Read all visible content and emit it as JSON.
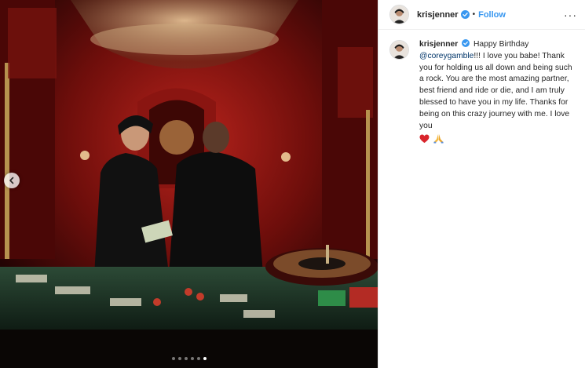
{
  "post": {
    "username": "krisjenner",
    "separator": "•",
    "follow_label": "Follow",
    "more_label": "···",
    "caption": {
      "greeting": "Happy Birthday",
      "mention": "@coreygamble",
      "text": "!!! I love you babe! Thank you for holding us all down and being such a rock. You are the most amazing partner, best friend and ride or die, and I am truly blessed to have you in my life. Thanks for being on this crazy journey with me. I love you",
      "emojis": [
        "red-heart-icon",
        "folded-hands-icon"
      ]
    },
    "carousel": {
      "total": 6,
      "active_index": 5
    }
  },
  "colors": {
    "link_blue": "#3897f0",
    "mention_blue": "#003569",
    "text": "#262626",
    "border": "#efefef"
  }
}
